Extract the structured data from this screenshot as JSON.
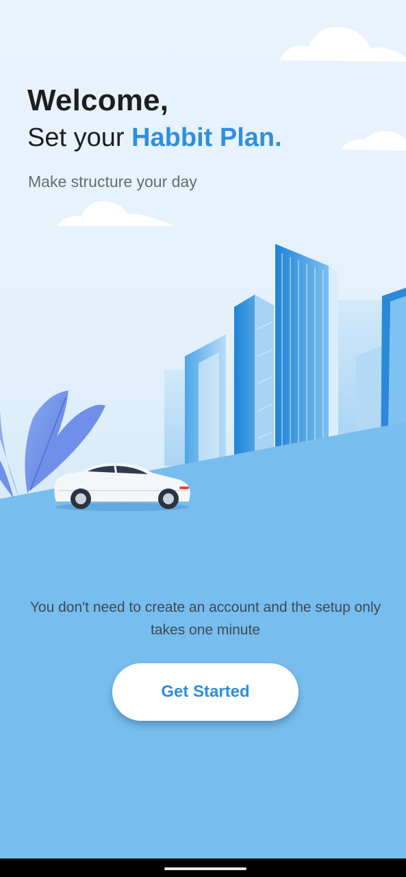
{
  "header": {
    "welcome": "Welcome,",
    "subtitle_prefix": "Set your ",
    "subtitle_highlight": "Habbit Plan.",
    "tagline": "Make structure your day"
  },
  "onboarding": {
    "info_text": "You don't need to create an account and the setup only takes one minute",
    "cta_label": "Get Started"
  },
  "colors": {
    "accent": "#2f8fdc",
    "ground": "#77bdee",
    "building_dark": "#1e7fd1",
    "building_light": "#9fd0f3"
  },
  "illustration": {
    "icons": [
      "cloud-icon",
      "city-buildings",
      "plant-leaves",
      "car-icon"
    ]
  }
}
